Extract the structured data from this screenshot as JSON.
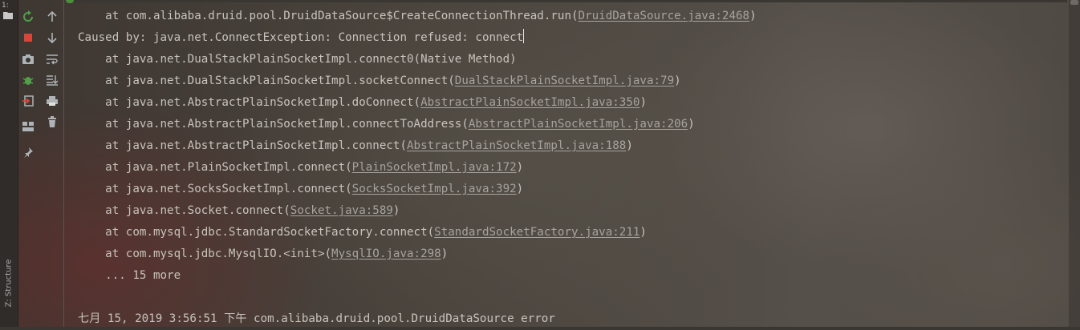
{
  "sidebar": {
    "top_tab_label": "1:",
    "structure_tab_label": "Z: Structure"
  },
  "toolbar": {
    "left_icons": [
      "rerun-icon",
      "stop-icon",
      "camera-icon",
      "debug-icon",
      "exit-icon",
      "layout-icon",
      "pin-icon"
    ],
    "right_icons": [
      "arrow-up-icon",
      "arrow-down-icon",
      "soft-wrap-icon",
      "scroll-to-end-icon",
      "print-icon",
      "trash-icon"
    ]
  },
  "console": {
    "lines": [
      {
        "prefix": "    at com.alibaba.druid.pool.DruidDataSource$CreateConnectionThread.run(",
        "link": "DruidDataSource.java:2468",
        "suffix": ")"
      },
      {
        "prefix": "Caused by: java.net.ConnectException: Connection refused: connect",
        "link": "",
        "suffix": ""
      },
      {
        "prefix": "    at java.net.DualStackPlainSocketImpl.connect0(Native Method)",
        "link": "",
        "suffix": ""
      },
      {
        "prefix": "    at java.net.DualStackPlainSocketImpl.socketConnect(",
        "link": "DualStackPlainSocketImpl.java:79",
        "suffix": ")"
      },
      {
        "prefix": "    at java.net.AbstractPlainSocketImpl.doConnect(",
        "link": "AbstractPlainSocketImpl.java:350",
        "suffix": ")"
      },
      {
        "prefix": "    at java.net.AbstractPlainSocketImpl.connectToAddress(",
        "link": "AbstractPlainSocketImpl.java:206",
        "suffix": ")"
      },
      {
        "prefix": "    at java.net.AbstractPlainSocketImpl.connect(",
        "link": "AbstractPlainSocketImpl.java:188",
        "suffix": ")"
      },
      {
        "prefix": "    at java.net.PlainSocketImpl.connect(",
        "link": "PlainSocketImpl.java:172",
        "suffix": ")"
      },
      {
        "prefix": "    at java.net.SocksSocketImpl.connect(",
        "link": "SocksSocketImpl.java:392",
        "suffix": ")"
      },
      {
        "prefix": "    at java.net.Socket.connect(",
        "link": "Socket.java:589",
        "suffix": ")"
      },
      {
        "prefix": "    at com.mysql.jdbc.StandardSocketFactory.connect(",
        "link": "StandardSocketFactory.java:211",
        "suffix": ")"
      },
      {
        "prefix": "    at com.mysql.jdbc.MysqlIO.<init>(",
        "link": "MysqlIO.java:298",
        "suffix": ")"
      },
      {
        "prefix": "    ... 15 more",
        "link": "",
        "suffix": ""
      },
      {
        "prefix": "",
        "link": "",
        "suffix": ""
      },
      {
        "prefix": "七月 15, 2019 3:56:51 下午 com.alibaba.druid.pool.DruidDataSource error",
        "link": "",
        "suffix": ""
      }
    ]
  },
  "colors": {
    "text": "#c8c3bc",
    "link": "#a6a39d",
    "stop": "#d9453a",
    "rerun": "#4fa048"
  }
}
